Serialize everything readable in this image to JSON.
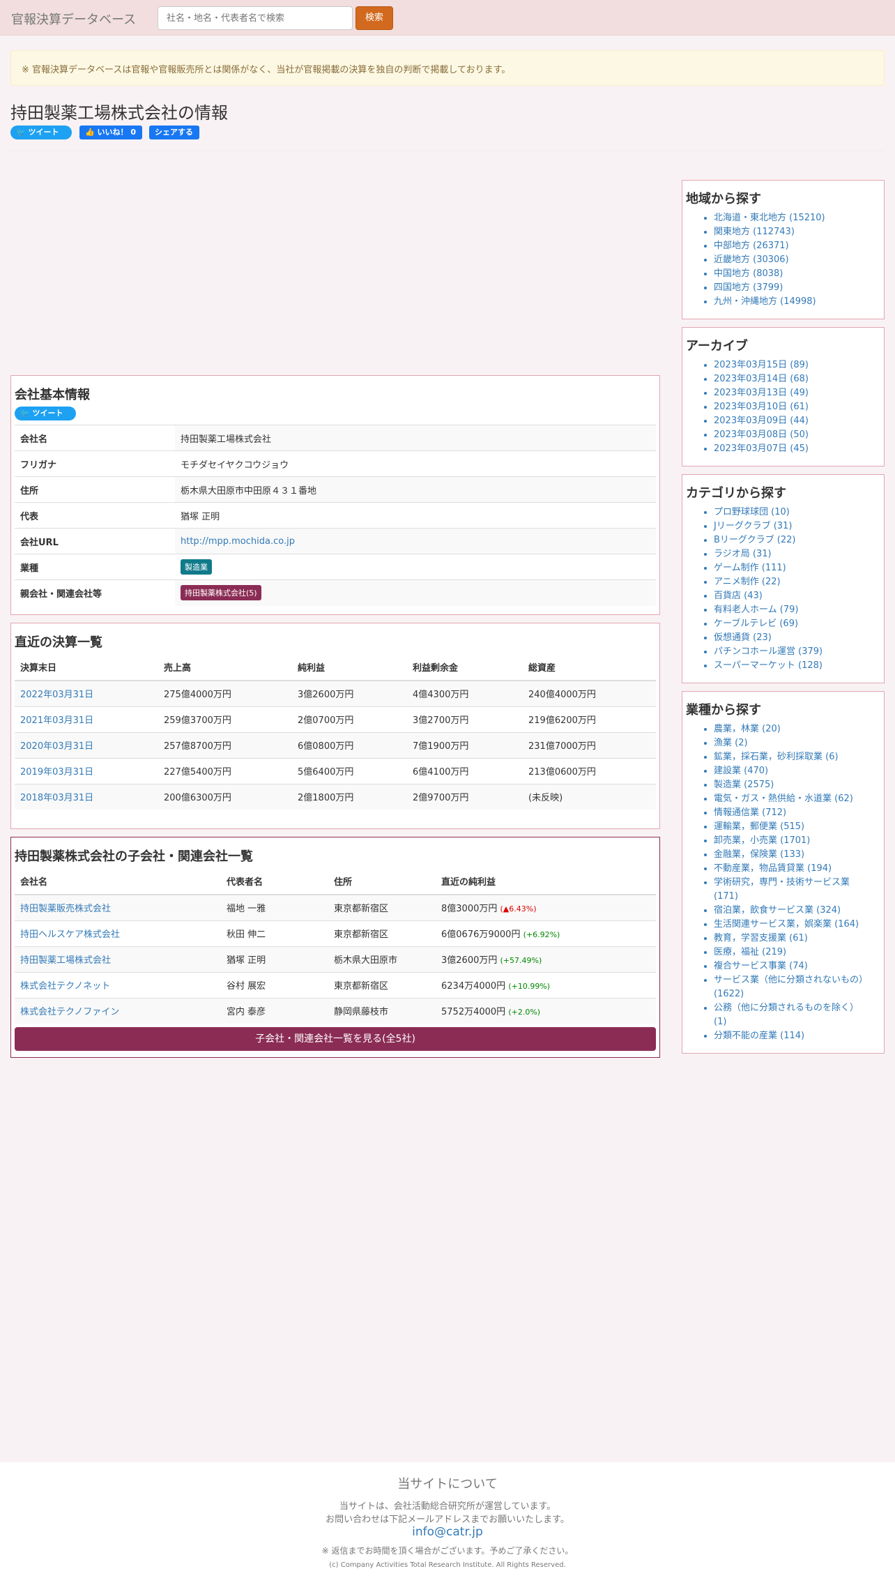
{
  "nav": {
    "brand": "官報決算データベース",
    "search_placeholder": "社名・地名・代表者名で検索",
    "search_button": "検索"
  },
  "notice": "※ 官報決算データベースは官報や官報販売所とは関係がなく、当社が官報掲載の決算を独自の判断で掲載しております。",
  "title": "持田製薬工場株式会社の情報",
  "social": {
    "tweet": "ツイート",
    "like": "いいね！ 0",
    "share": "シェアする"
  },
  "basic": {
    "heading": "会社基本情報",
    "tweet": "ツイート",
    "rows": [
      {
        "label": "会社名",
        "value": "持田製薬工場株式会社"
      },
      {
        "label": "フリガナ",
        "value": "モチダセイヤクコウジョウ"
      },
      {
        "label": "住所",
        "value": "栃木県大田原市中田原４３１番地"
      },
      {
        "label": "代表",
        "value": "猶塚 正明"
      },
      {
        "label": "会社URL",
        "value": "http://mpp.mochida.co.jp"
      },
      {
        "label": "業種",
        "value": "製造業"
      },
      {
        "label": "親会社・関連会社等",
        "value": "持田製薬株式会社(5)"
      }
    ]
  },
  "financials": {
    "heading": "直近の決算一覧",
    "headers": [
      "決算末日",
      "売上高",
      "純利益",
      "利益剰余金",
      "総資産"
    ],
    "rows": [
      [
        "2022年03月31日",
        "275億4000万円",
        "3億2600万円",
        "4億4300万円",
        "240億4000万円"
      ],
      [
        "2021年03月31日",
        "259億3700万円",
        "2億0700万円",
        "3億2700万円",
        "219億6200万円"
      ],
      [
        "2020年03月31日",
        "257億8700万円",
        "6億0800万円",
        "7億1900万円",
        "231億7000万円"
      ],
      [
        "2019年03月31日",
        "227億5400万円",
        "5億6400万円",
        "6億4100万円",
        "213億0600万円"
      ],
      [
        "2018年03月31日",
        "200億6300万円",
        "2億1800万円",
        "2億9700万円",
        "(未反映)"
      ]
    ]
  },
  "subsidiaries": {
    "heading": "持田製薬株式会社の子会社・関連会社一覧",
    "headers": [
      "会社名",
      "代表者名",
      "住所",
      "直近の純利益"
    ],
    "rows": [
      [
        "持田製薬販売株式会社",
        "福地 一雅",
        "東京都新宿区",
        "8億3000万円",
        "(▲6.43%)"
      ],
      [
        "持田ヘルスケア株式会社",
        "秋田 伸二",
        "東京都新宿区",
        "6億0676万9000円",
        "(+6.92%)"
      ],
      [
        "持田製薬工場株式会社",
        "猶塚 正明",
        "栃木県大田原市",
        "3億2600万円",
        "(+57.49%)"
      ],
      [
        "株式会社テクノネット",
        "谷村 展宏",
        "東京都新宿区",
        "6234万4000円",
        "(+10.99%)"
      ],
      [
        "株式会社テクノファイン",
        "宮内 泰彦",
        "静岡県藤枝市",
        "5752万4000円",
        "(+2.0%)"
      ]
    ],
    "more_button": "子会社・関連会社一覧を見る(全5社)"
  },
  "sidebar": {
    "region": {
      "heading": "地域から探す",
      "items": [
        "北海道・東北地方 (15210)",
        "関東地方 (112743)",
        "中部地方 (26371)",
        "近畿地方 (30306)",
        "中国地方 (8038)",
        "四国地方 (3799)",
        "九州・沖縄地方 (14998)"
      ]
    },
    "archive": {
      "heading": "アーカイブ",
      "items": [
        "2023年03月15日 (89)",
        "2023年03月14日 (68)",
        "2023年03月13日 (49)",
        "2023年03月10日 (61)",
        "2023年03月09日 (44)",
        "2023年03月08日 (50)",
        "2023年03月07日 (45)"
      ]
    },
    "category": {
      "heading": "カテゴリから探す",
      "items": [
        "プロ野球球団 (10)",
        "Jリーグクラブ (31)",
        "Bリーグクラブ (22)",
        "ラジオ局 (31)",
        "ゲーム制作 (111)",
        "アニメ制作 (22)",
        "百貨店 (43)",
        "有料老人ホーム (79)",
        "ケーブルテレビ (69)",
        "仮想通貨 (23)",
        "パチンコホール運営 (379)",
        "スーパーマーケット (128)"
      ]
    },
    "industry": {
      "heading": "業種から探す",
      "items": [
        "農業，林業 (20)",
        "漁業 (2)",
        "鉱業，採石業，砂利採取業 (6)",
        "建設業 (470)",
        "製造業 (2575)",
        "電気・ガス・熱供給・水道業 (62)",
        "情報通信業 (712)",
        "運輸業，郵便業 (515)",
        "卸売業，小売業 (1701)",
        "金融業，保険業 (133)",
        "不動産業，物品賃貸業 (194)",
        "学術研究，専門・技術サービス業 (171)",
        "宿泊業，飲食サービス業 (324)",
        "生活関連サービス業，娯楽業 (164)",
        "教育，学習支援業 (61)",
        "医療，福祉 (219)",
        "複合サービス事業 (74)",
        "サービス業（他に分類されないもの） (1622)",
        "公務（他に分類されるものを除く） (1)",
        "分類不能の産業 (114)"
      ]
    }
  },
  "footer": {
    "title": "当サイトについて",
    "line1": "当サイトは、会社活動総合研究所が運営しています。",
    "line2": "お問い合わせは下記メールアドレスまでお願いいたします。",
    "email": "info@catr.jp",
    "note": "※ 返信までお時間を頂く場合がございます。予めご了承ください。",
    "copyright": "(c) Company Activities Total Research Institute. All Rights Reserved."
  }
}
